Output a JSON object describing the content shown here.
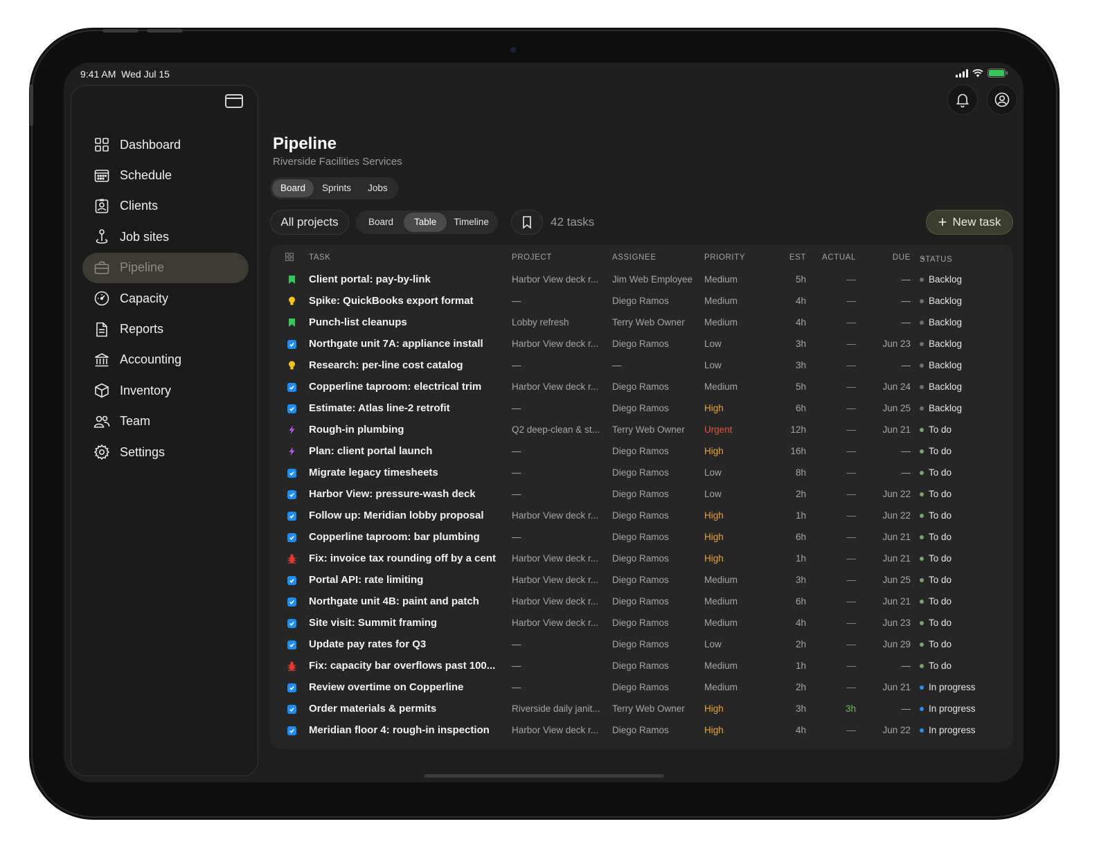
{
  "status_bar": {
    "time": "9:41 AM",
    "date": "Wed Jul 15"
  },
  "colors": {
    "accent_new_task": "#3b3e2f",
    "checkbox_blue": "#1f8ef1",
    "priority_high": "#e8a23c",
    "priority_urgent": "#e2533f",
    "status_backlog": "#6f6f6f",
    "status_todo": "#7fa16a",
    "status_in_progress": "#2d8cf0"
  },
  "sidebar": {
    "items": [
      {
        "label": "Dashboard",
        "icon": "grid-icon"
      },
      {
        "label": "Schedule",
        "icon": "calendar-icon"
      },
      {
        "label": "Clients",
        "icon": "contact-card-icon"
      },
      {
        "label": "Job sites",
        "icon": "map-pin-icon"
      },
      {
        "label": "Pipeline",
        "icon": "briefcase-icon",
        "active": true
      },
      {
        "label": "Capacity",
        "icon": "gauge-icon"
      },
      {
        "label": "Reports",
        "icon": "document-icon"
      },
      {
        "label": "Accounting",
        "icon": "bank-icon"
      },
      {
        "label": "Inventory",
        "icon": "box-icon"
      },
      {
        "label": "Team",
        "icon": "people-icon"
      },
      {
        "label": "Settings",
        "icon": "gear-icon"
      }
    ]
  },
  "header": {
    "title": "Pipeline",
    "subtitle": "Riverside Facilities Services",
    "tabs": [
      "Board",
      "Sprints",
      "Jobs"
    ],
    "active_tab": "Board"
  },
  "toolbar": {
    "project_filter": "All projects",
    "views": [
      "Board",
      "Table",
      "Timeline"
    ],
    "active_view": "Table",
    "task_count": "42 tasks",
    "new_task_label": "New task"
  },
  "table": {
    "columns": {
      "task": "TASK",
      "project": "PROJECT",
      "assignee": "ASSIGNEE",
      "priority": "PRIORITY",
      "est": "EST",
      "actual": "ACTUAL",
      "due": "DUE",
      "status": "STATUS"
    },
    "rows": [
      {
        "type": "story",
        "task": "Client portal: pay-by-link",
        "project": "Harbor View deck r...",
        "assignee": "Jim Web Employee",
        "priority": "Medium",
        "est": "5h",
        "actual": "—",
        "due": "—",
        "status": "Backlog"
      },
      {
        "type": "spike",
        "task": "Spike: QuickBooks export format",
        "project": "—",
        "assignee": "Diego Ramos",
        "priority": "Medium",
        "est": "4h",
        "actual": "—",
        "due": "—",
        "status": "Backlog"
      },
      {
        "type": "story",
        "task": "Punch-list cleanups",
        "project": "Lobby refresh",
        "assignee": "Terry Web Owner",
        "priority": "Medium",
        "est": "4h",
        "actual": "—",
        "due": "—",
        "status": "Backlog"
      },
      {
        "type": "task",
        "task": "Northgate unit 7A: appliance install",
        "project": "Harbor View deck r...",
        "assignee": "Diego Ramos",
        "priority": "Low",
        "est": "3h",
        "actual": "—",
        "due": "Jun 23",
        "status": "Backlog"
      },
      {
        "type": "spike",
        "task": "Research: per-line cost catalog",
        "project": "—",
        "assignee": "—",
        "priority": "Low",
        "est": "3h",
        "actual": "—",
        "due": "—",
        "status": "Backlog"
      },
      {
        "type": "task",
        "task": "Copperline taproom: electrical trim",
        "project": "Harbor View deck r...",
        "assignee": "Diego Ramos",
        "priority": "Medium",
        "est": "5h",
        "actual": "—",
        "due": "Jun 24",
        "status": "Backlog"
      },
      {
        "type": "task",
        "task": "Estimate: Atlas line-2 retrofit",
        "project": "—",
        "assignee": "Diego Ramos",
        "priority": "High",
        "est": "6h",
        "actual": "—",
        "due": "Jun 25",
        "status": "Backlog"
      },
      {
        "type": "epic",
        "task": "Rough-in plumbing",
        "project": "Q2 deep-clean & st...",
        "assignee": "Terry Web Owner",
        "priority": "Urgent",
        "est": "12h",
        "actual": "—",
        "due": "Jun 21",
        "status": "To do"
      },
      {
        "type": "epic",
        "task": "Plan: client portal launch",
        "project": "—",
        "assignee": "Diego Ramos",
        "priority": "High",
        "est": "16h",
        "actual": "—",
        "due": "—",
        "status": "To do"
      },
      {
        "type": "task",
        "task": "Migrate legacy timesheets",
        "project": "—",
        "assignee": "Diego Ramos",
        "priority": "Low",
        "est": "8h",
        "actual": "—",
        "due": "—",
        "status": "To do"
      },
      {
        "type": "task",
        "task": "Harbor View: pressure-wash deck",
        "project": "—",
        "assignee": "Diego Ramos",
        "priority": "Low",
        "est": "2h",
        "actual": "—",
        "due": "Jun 22",
        "status": "To do"
      },
      {
        "type": "task",
        "task": "Follow up: Meridian lobby proposal",
        "project": "Harbor View deck r...",
        "assignee": "Diego Ramos",
        "priority": "High",
        "est": "1h",
        "actual": "—",
        "due": "Jun 22",
        "status": "To do"
      },
      {
        "type": "task",
        "task": "Copperline taproom: bar plumbing",
        "project": "—",
        "assignee": "Diego Ramos",
        "priority": "High",
        "est": "6h",
        "actual": "—",
        "due": "Jun 21",
        "status": "To do"
      },
      {
        "type": "bug",
        "task": "Fix: invoice tax rounding off by a cent",
        "project": "Harbor View deck r...",
        "assignee": "Diego Ramos",
        "priority": "High",
        "est": "1h",
        "actual": "—",
        "due": "Jun 21",
        "status": "To do"
      },
      {
        "type": "task",
        "task": "Portal API: rate limiting",
        "project": "Harbor View deck r...",
        "assignee": "Diego Ramos",
        "priority": "Medium",
        "est": "3h",
        "actual": "—",
        "due": "Jun 25",
        "status": "To do"
      },
      {
        "type": "task",
        "task": "Northgate unit 4B: paint and patch",
        "project": "Harbor View deck r...",
        "assignee": "Diego Ramos",
        "priority": "Medium",
        "est": "6h",
        "actual": "—",
        "due": "Jun 21",
        "status": "To do"
      },
      {
        "type": "task",
        "task": "Site visit: Summit framing",
        "project": "Harbor View deck r...",
        "assignee": "Diego Ramos",
        "priority": "Medium",
        "est": "4h",
        "actual": "—",
        "due": "Jun 23",
        "status": "To do"
      },
      {
        "type": "task",
        "task": "Update pay rates for Q3",
        "project": "—",
        "assignee": "Diego Ramos",
        "priority": "Low",
        "est": "2h",
        "actual": "—",
        "due": "Jun 29",
        "status": "To do"
      },
      {
        "type": "bug",
        "task": "Fix: capacity bar overflows past 100...",
        "project": "—",
        "assignee": "Diego Ramos",
        "priority": "Medium",
        "est": "1h",
        "actual": "—",
        "due": "—",
        "status": "To do"
      },
      {
        "type": "task",
        "task": "Review overtime on Copperline",
        "project": "—",
        "assignee": "Diego Ramos",
        "priority": "Medium",
        "est": "2h",
        "actual": "—",
        "due": "Jun 21",
        "status": "In progress"
      },
      {
        "type": "task",
        "task": "Order materials & permits",
        "project": "Riverside daily janit...",
        "assignee": "Terry Web Owner",
        "priority": "High",
        "est": "3h",
        "actual": "3h",
        "due": "—",
        "status": "In progress"
      },
      {
        "type": "task",
        "task": "Meridian floor 4: rough-in inspection",
        "project": "Harbor View deck r...",
        "assignee": "Diego Ramos",
        "priority": "High",
        "est": "4h",
        "actual": "—",
        "due": "Jun 22",
        "status": "In progress"
      }
    ]
  }
}
